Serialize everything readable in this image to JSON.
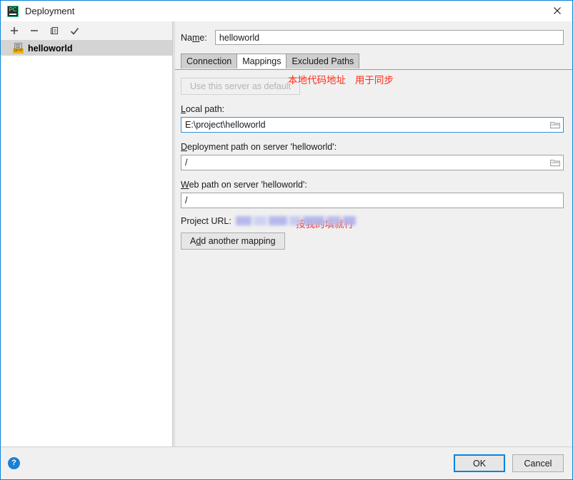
{
  "window": {
    "title": "Deployment",
    "app_icon": "pycharm-icon",
    "app_icon_text": "PC",
    "close_icon": "close-icon"
  },
  "left_pane": {
    "toolbar": [
      {
        "name": "add-server-button",
        "icon": "plus-icon"
      },
      {
        "name": "remove-server-button",
        "icon": "minus-icon"
      },
      {
        "name": "copy-server-button",
        "icon": "copy-icon"
      },
      {
        "name": "set-default-server-button",
        "icon": "check-icon"
      }
    ],
    "servers": [
      {
        "label": "helloworld",
        "icon": "sftp-icon",
        "badge": "SFTP",
        "selected": true
      }
    ]
  },
  "form": {
    "name_label": "Name:",
    "name_label_mnemonic": "m",
    "name_value": "helloworld",
    "tabs": [
      {
        "label": "Connection",
        "active": false
      },
      {
        "label": "Mappings",
        "active": true
      },
      {
        "label": "Excluded Paths",
        "active": false
      }
    ],
    "use_default_button": "Use this server as default",
    "local_path": {
      "label_prefix": "",
      "label": "Local path:",
      "label_mnemonic": "L",
      "value": "E:\\project\\helloworld",
      "browse_icon": "folder-icon",
      "annotation": "本地代码地址   用于同步"
    },
    "deployment_path": {
      "label": "Deployment path on server 'helloworld':",
      "label_mnemonic": "D",
      "value": "/",
      "browse_icon": "folder-icon",
      "annotation": "按我的填就行"
    },
    "web_path": {
      "label": "Web path on server 'helloworld':",
      "label_mnemonic": "W",
      "value": "/"
    },
    "project_url": {
      "label": "Project URL:",
      "value_redacted": true
    },
    "add_mapping_button": "Add another mapping",
    "add_mapping_mnemonic": "d"
  },
  "footer": {
    "help_icon": "help-icon",
    "help_glyph": "?",
    "ok_button": "OK",
    "cancel_button": "Cancel"
  },
  "colors": {
    "accent": "#0a84d8",
    "annotation_red": "#ff2a17",
    "selection_gray": "#d4d4d4",
    "dialog_bg": "#f0f0f0",
    "sftp_badge": "#f0b400"
  }
}
